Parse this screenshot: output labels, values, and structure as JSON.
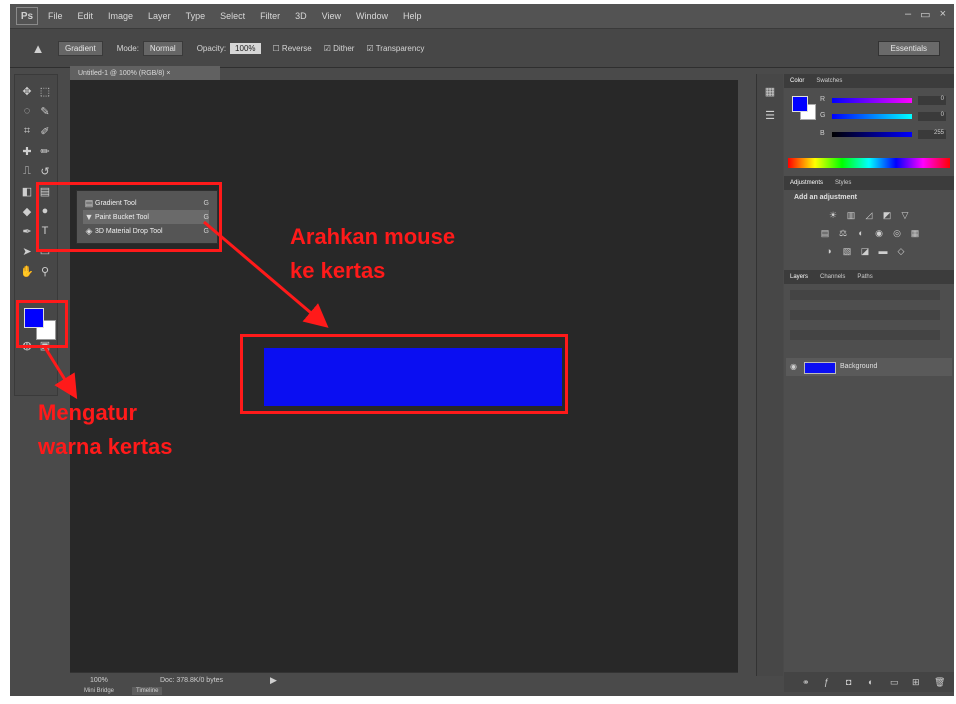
{
  "app": {
    "logo": "Ps",
    "menu": [
      "File",
      "Edit",
      "Image",
      "Layer",
      "Type",
      "Select",
      "Filter",
      "3D",
      "View",
      "Window",
      "Help"
    ],
    "window_controls": [
      "–",
      "▭",
      "×"
    ]
  },
  "options_bar": {
    "tool_icon": "gradient-tool-icon",
    "preset_label": "Gradient",
    "mode_label": "Mode:",
    "mode_value": "Normal",
    "opacity_label": "Opacity:",
    "opacity_value": "100%",
    "reverse_label": "Reverse",
    "dither_label": "Dither",
    "transparency_label": "Transparency",
    "workspace_label": "Essentials"
  },
  "document": {
    "tab_title": "Untitled-1 @ 100% (RGB/8) ×",
    "zoom": "100%",
    "doc_info": "Doc: 378.8K/0 bytes",
    "bottom_tabs": [
      "Mini Bridge",
      "Timeline"
    ]
  },
  "tool_flyout": {
    "items": [
      {
        "icon": "gradient-tool-icon",
        "label": "Gradient Tool",
        "key": "G"
      },
      {
        "icon": "paint-bucket-tool-icon",
        "label": "Paint Bucket Tool",
        "key": "G"
      },
      {
        "icon": "3d-material-drop-tool-icon",
        "label": "3D Material Drop Tool",
        "key": "G"
      }
    ]
  },
  "colors": {
    "foreground": "#0000ff",
    "background": "#ffffff",
    "paper_fill": "#0a0ef2",
    "annotation": "#ff1a1a"
  },
  "color_panel": {
    "tabs": [
      "Color",
      "Swatches"
    ],
    "sliders": [
      {
        "label": "R",
        "value": "0"
      },
      {
        "label": "G",
        "value": "0"
      },
      {
        "label": "B",
        "value": "255"
      }
    ]
  },
  "adjustments_panel": {
    "tabs": [
      "Adjustments",
      "Styles"
    ],
    "title": "Add an adjustment"
  },
  "layers_panel": {
    "tabs": [
      "Layers",
      "Channels",
      "Paths"
    ],
    "layer_name": "Background"
  },
  "annotations": {
    "move_mouse": [
      "Arahkan mouse",
      "ke kertas"
    ],
    "set_color": [
      "Mengatur",
      "warna kertas"
    ]
  }
}
